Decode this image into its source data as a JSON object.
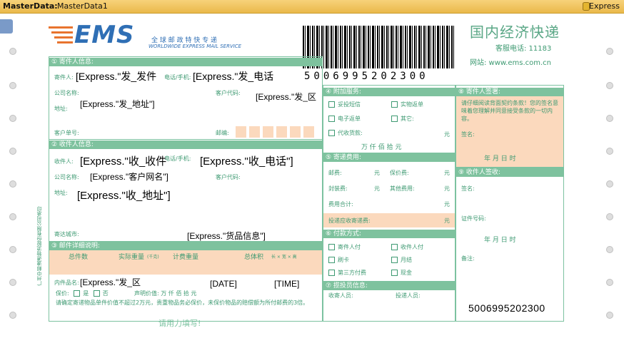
{
  "titlebar": {
    "label": "MasterData:",
    "value": "MasterData1",
    "datasource": "Express"
  },
  "form": {
    "ems_logo": "EMS",
    "logo_cn": "全 球 邮 政 特 快 专 递",
    "logo_en": "WORLDWIDE EXPRESS MAIL SERVICE",
    "title_cn": "国内经济快递",
    "hotline": "客服电话: 11183",
    "website": "网站: www.ems.com.cn",
    "barcode_number": "5006995202300",
    "sender_section": "① 寄件人信息:",
    "sender_name_label": "寄件人:",
    "sender_phone_label": "电话/手机:",
    "sender_company_label": "公司名称:",
    "sender_customer_code_label": "客户代码:",
    "sender_address_label": "地址:",
    "sender_account_label": "客户单号:",
    "sender_postcode_label": "邮编:",
    "receiver_section": "② 收件人信息:",
    "receiver_name_label": "收件人:",
    "receiver_phone_label": "电话/手机:",
    "receiver_company_label": "公司名称:",
    "receiver_customer_code_label": "客户代码:",
    "receiver_address_label": "地址:",
    "dest_city_label": "寄达城市:",
    "detail_section": "③ 邮件详细说明:",
    "detail_cols": [
      "总件数",
      "实际重量",
      "计费重量",
      "总体积"
    ],
    "weight_unit": "(千克)",
    "volume_unit": "长 × 宽 × 高",
    "content_label": "内件品名:",
    "insured_label": "保价:",
    "yes_label": "是",
    "no_label": "否",
    "declared_value": "声明价值:  万  仟  佰  拾  元",
    "insurance_notice": "请确定寄递物品单件价值不超过2万元，贵重物品务必保价，未保价物品的赔偿额为所付邮费的3倍。",
    "write_hard": "请用力填写!",
    "addl_section": "④ 附加服务:",
    "addl_items": [
      "妥投短信",
      "实物返单",
      "电子返单",
      "其它:",
      "代收货款:"
    ],
    "yuan": "元",
    "amount_units": "万  仟  佰  拾  元",
    "fee_section": "⑤ 寄递费用:",
    "postage_label": "邮费:",
    "insurance_fee_label": "保价费:",
    "packing_fee_label": "封装费:",
    "other_fee_label": "其他费用:",
    "total_fee_label": "费用合计:",
    "total_payable_label": "投递应收寄递费:",
    "pay_section": "⑥ 付款方式:",
    "pay_items": [
      "寄件人付",
      "收件人付",
      "刷卡",
      "月结",
      "第三方付费",
      "现金"
    ],
    "collector_section": "⑦ 揽投员信息:",
    "collector_label": "收寄人员:",
    "deliverer_label": "投递人员:",
    "sender_sign_section": "⑧ 寄件人签署:",
    "sender_sign_text": "请仔细阅读背面契约条款！您的签名意味着您理解并同意接受条款的一切内容。",
    "sign_label": "签名:",
    "date_units": "年  月  日  时",
    "receiver_sign_section": "⑨ 收件人签收:",
    "id_label": "证件号码:",
    "remark_label": "备注:",
    "side_text": "广州中邮速递物流股份有限公司承印",
    "bottom_number": "5006995202300"
  },
  "fields": {
    "sender_name": "[Express.\"发_发件",
    "sender_phone": "[Express.\"发_电话",
    "sender_region": "[Express.\"发_区",
    "sender_address": "[Express.\"发_地址\"]",
    "receiver_name": "[Express.\"收_收件",
    "receiver_phone": "[Express.\"收_电话\"]",
    "customer_name": "[Express.\"客户网名\"]",
    "receiver_address": "[Express.\"收_地址\"]",
    "goods_info": "[Express.\"货品信息\"]",
    "sender_region2": "[Express.\"发_区",
    "date": "[DATE]",
    "time": "[TIME]"
  }
}
